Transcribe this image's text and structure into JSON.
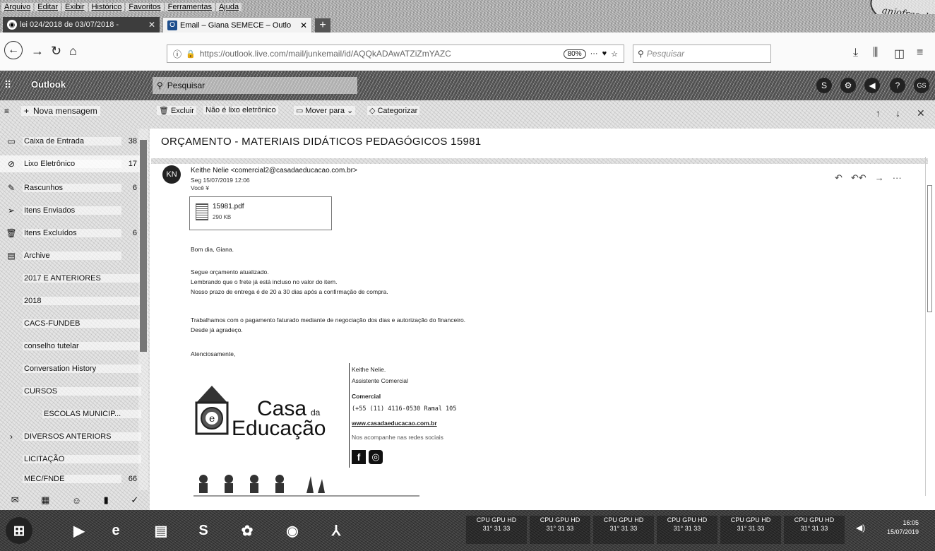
{
  "menubar": {
    "items": [
      "Arquivo",
      "Editar",
      "Exibir",
      "Histórico",
      "Favoritos",
      "Ferramentas",
      "Ajuda"
    ]
  },
  "stamp": {
    "text": "anjofras do"
  },
  "tabs": [
    {
      "title": "lei 024/2018 de 03/07/2018 - ",
      "icon": "chrome-icon"
    },
    {
      "title": "Email – Giana SEMECE – Outlo",
      "icon": "outlook-icon"
    }
  ],
  "nav": {
    "url": "https://outlook.live.com/mail/junkemail/id/AQQkADAwATZiZmYAZC",
    "zoom": "80%",
    "search_placeholder": "Pesquisar"
  },
  "outlook": {
    "app_name": "Outlook",
    "search_placeholder": "Pesquisar",
    "user_initials": "GS"
  },
  "commands": {
    "new_message": "Nova mensagem",
    "delete": "Excluir",
    "not_junk": "Não é lixo eletrônico",
    "move_to": "Mover para",
    "categorize": "Categorizar"
  },
  "folders": [
    {
      "name": "Caixa de Entrada",
      "count": "38",
      "icon": "inbox-icon"
    },
    {
      "name": "Lixo Eletrônico",
      "count": "17",
      "icon": "junk-icon",
      "selected": true
    },
    {
      "name": "Rascunhos",
      "count": "6",
      "icon": "draft-icon"
    },
    {
      "name": "Itens Enviados",
      "count": "",
      "icon": "send-icon"
    },
    {
      "name": "Itens Excluídos",
      "count": "6",
      "icon": "trash-icon"
    },
    {
      "name": "Archive",
      "count": "",
      "icon": "archive-icon"
    },
    {
      "name": "2017 E ANTERIORES",
      "count": "",
      "icon": ""
    },
    {
      "name": "2018",
      "count": "",
      "icon": ""
    },
    {
      "name": "CACS-FUNDEB",
      "count": "",
      "icon": ""
    },
    {
      "name": "conselho tutelar",
      "count": "",
      "icon": ""
    },
    {
      "name": "Conversation History",
      "count": "",
      "icon": ""
    },
    {
      "name": "CURSOS",
      "count": "",
      "icon": ""
    },
    {
      "name": "ESCOLAS MUNICIP...",
      "count": "",
      "icon": ""
    },
    {
      "name": "DIVERSOS ANTERIORS",
      "count": "",
      "icon": ""
    },
    {
      "name": "LICITAÇÃO",
      "count": "",
      "icon": ""
    },
    {
      "name": "MEC/FNDE",
      "count": "66",
      "icon": ""
    }
  ],
  "email": {
    "subject": "ORÇAMENTO - MATERIAIS DIDÁTICOS PEDAGÓGICOS 15981",
    "avatar_initials": "KN",
    "sender": "Keithe Nelie <comercial2@casadaeducacao.com.br>",
    "date": "Seg 15/07/2019 12:06",
    "to": "Você ¥",
    "attachment_name": "15981.pdf",
    "attachment_size": "290 KB",
    "body": [
      "Bom dia, Giana.",
      "Segue orçamento atualizado.",
      "Lembrando que o frete já está incluso no valor do item.",
      "Nosso prazo de entrega é de 20 a 30 dias após a confirmação de compra.",
      "Trabalhamos com o pagamento faturado mediante de negociação dos dias e autorização do financeiro.",
      "Desde já agradeço.",
      "Atenciosamente,"
    ],
    "signature": {
      "name": "Keithe Nelie.",
      "role": "Assistente Comercial",
      "dept": "Comercial",
      "phone": "(+55 (11) 4116-0530  Ramal 105",
      "site": "www.casadaeducacao.com.br",
      "social": "Nos acompanhe nas redes sociais",
      "logo_word1": "Casa",
      "logo_small": "da",
      "logo_word2": "Educação"
    }
  },
  "taskbar": {
    "gadgets": [
      {
        "title": "CPU GPU HD",
        "values": "31° 31 33"
      },
      {
        "title": "CPU GPU HD",
        "values": "31° 31 33"
      },
      {
        "title": "CPU GPU HD",
        "values": "31° 31 33"
      },
      {
        "title": "CPU GPU HD",
        "values": "31° 31 33"
      },
      {
        "title": "CPU GPU HD",
        "values": "31° 31 33"
      },
      {
        "title": "CPU GPU HD",
        "values": "31° 31 33"
      }
    ],
    "time": "16:05",
    "date": "15/07/2019"
  }
}
